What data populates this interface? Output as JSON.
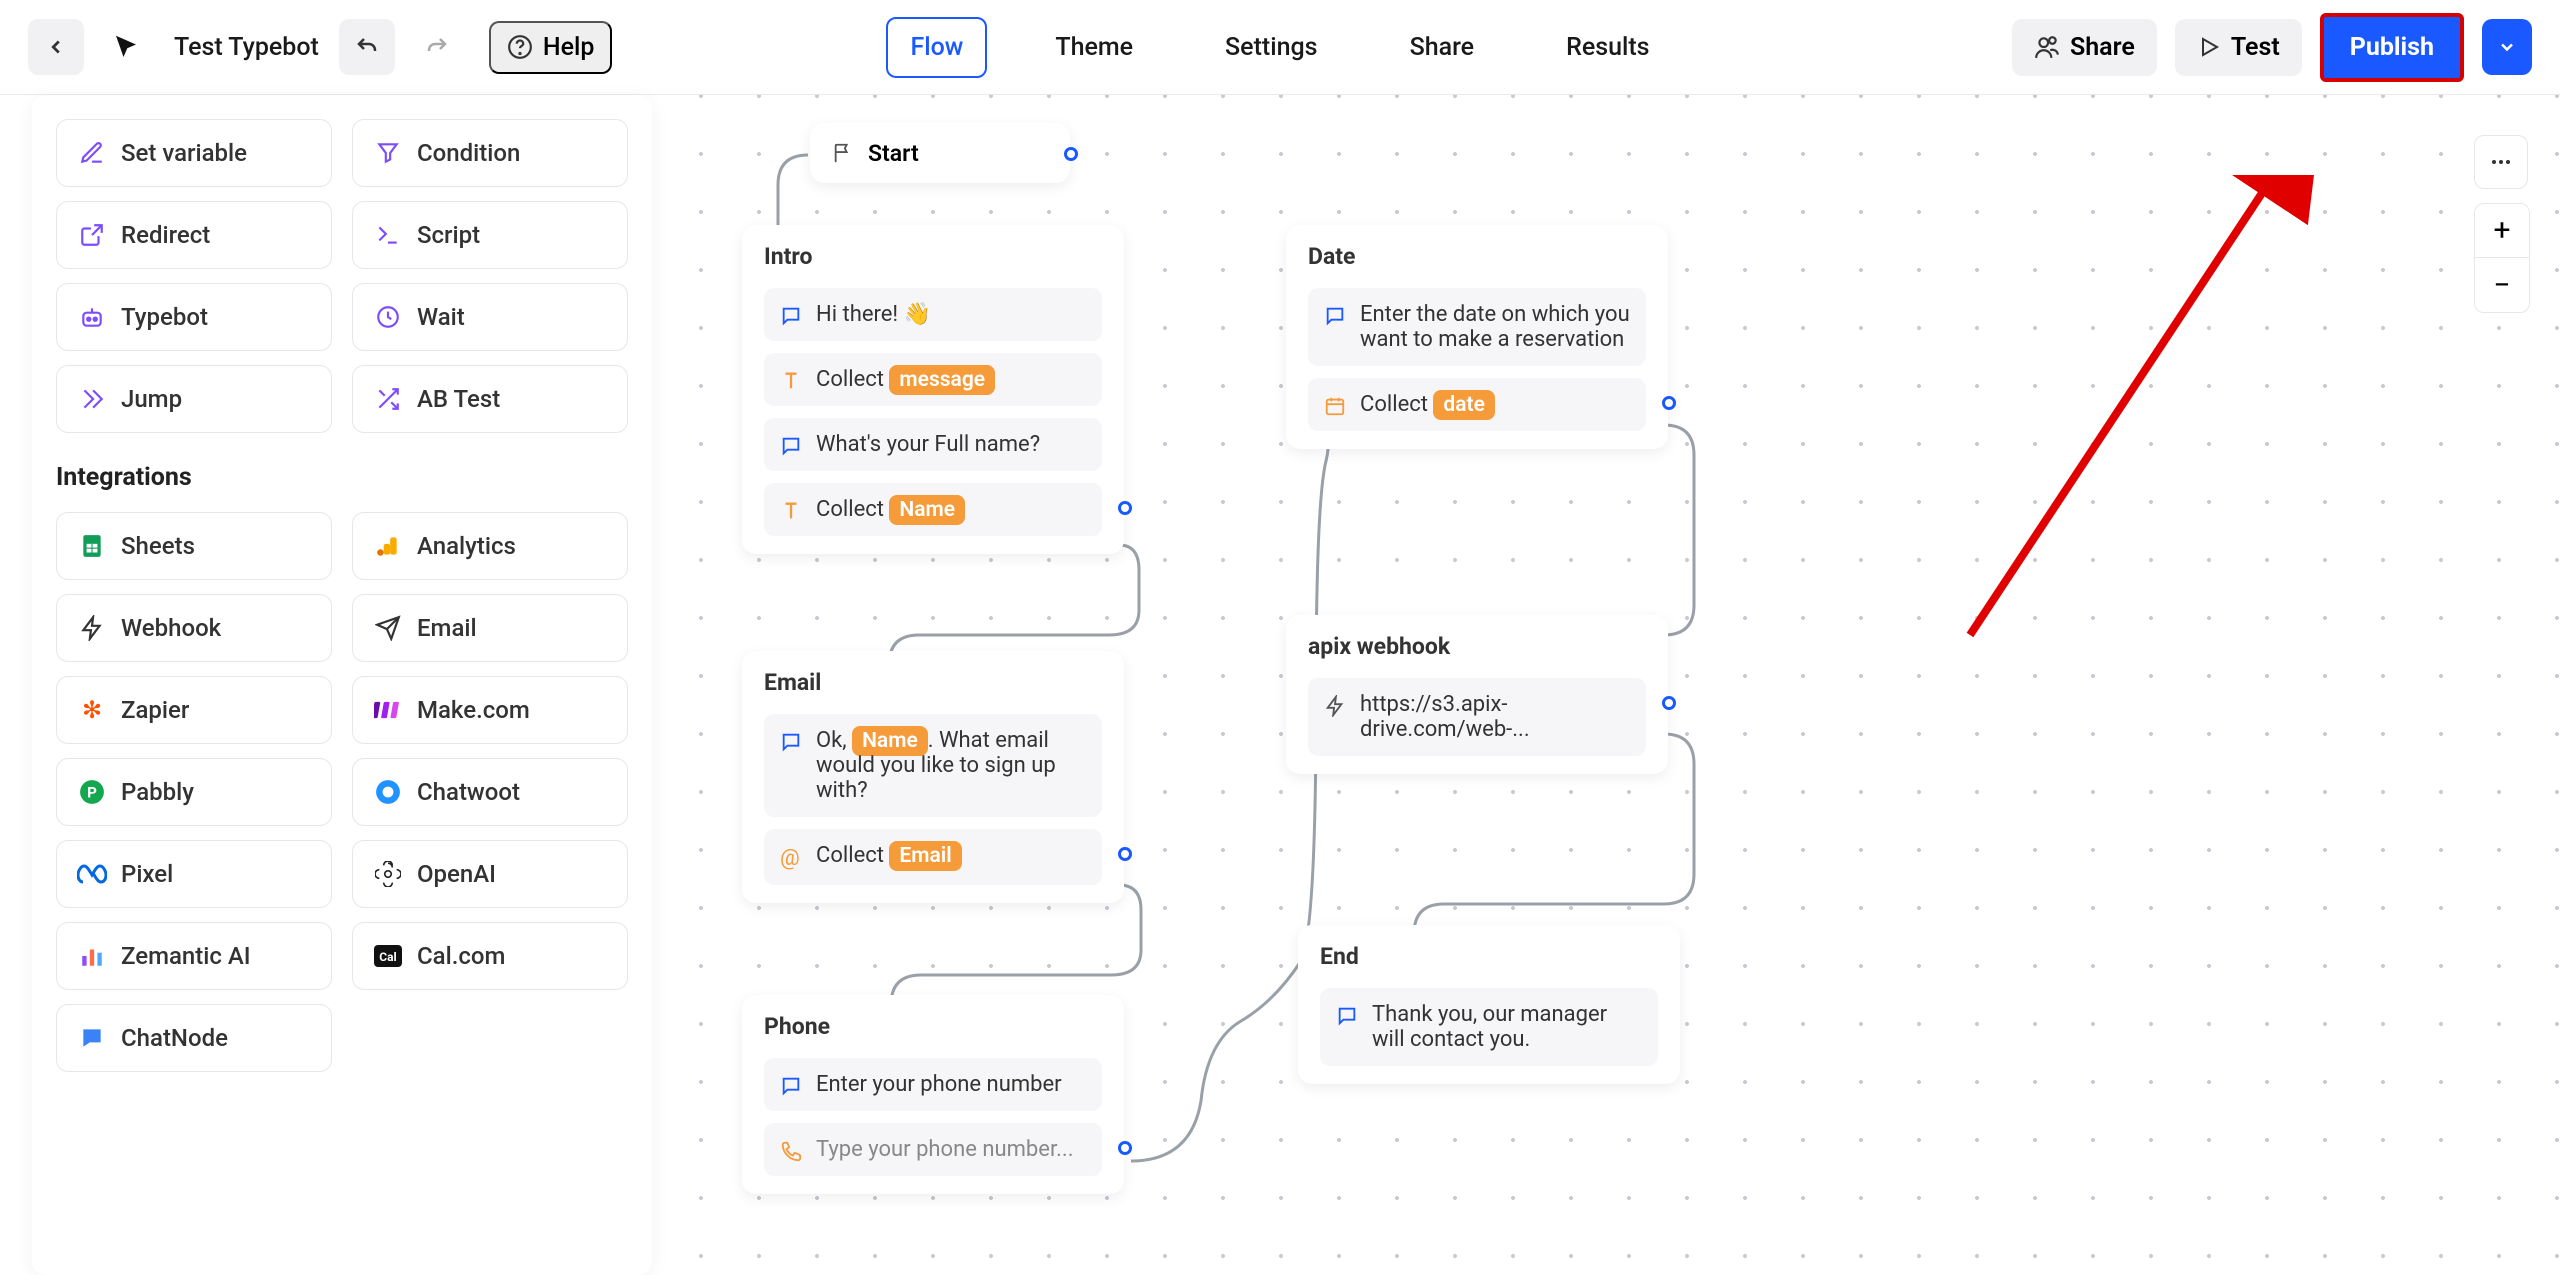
{
  "header": {
    "title": "Test Typebot",
    "help": "Help",
    "tabs": {
      "flow": "Flow",
      "theme": "Theme",
      "settings": "Settings",
      "share": "Share",
      "results": "Results"
    },
    "share_btn": "Share",
    "test_btn": "Test",
    "publish_btn": "Publish"
  },
  "palette": {
    "blocks": [
      {
        "icon": "pencil",
        "label": "Set variable"
      },
      {
        "icon": "filter",
        "label": "Condition"
      },
      {
        "icon": "redirect",
        "label": "Redirect"
      },
      {
        "icon": "script",
        "label": "Script"
      },
      {
        "icon": "bot",
        "label": "Typebot"
      },
      {
        "icon": "clock",
        "label": "Wait"
      },
      {
        "icon": "jump",
        "label": "Jump"
      },
      {
        "icon": "abtest",
        "label": "AB Test"
      }
    ],
    "integrations_h": "Integrations",
    "integrations": [
      {
        "icon": "sheets",
        "label": "Sheets"
      },
      {
        "icon": "analytics",
        "label": "Analytics"
      },
      {
        "icon": "webhook",
        "label": "Webhook"
      },
      {
        "icon": "email",
        "label": "Email"
      },
      {
        "icon": "zapier",
        "label": "Zapier"
      },
      {
        "icon": "make",
        "label": "Make.com"
      },
      {
        "icon": "pabbly",
        "label": "Pabbly"
      },
      {
        "icon": "chatwoot",
        "label": "Chatwoot"
      },
      {
        "icon": "pixel",
        "label": "Pixel"
      },
      {
        "icon": "openai",
        "label": "OpenAI"
      },
      {
        "icon": "zemantic",
        "label": "Zemantic AI"
      },
      {
        "icon": "calcom",
        "label": "Cal.com"
      },
      {
        "icon": "chatnode",
        "label": "ChatNode"
      }
    ]
  },
  "flow": {
    "start": "Start",
    "intro": {
      "title": "Intro",
      "b1": "Hi there!  👋",
      "b2_pre": "Collect ",
      "b2_tag": "message",
      "b3": "What's your Full name?",
      "b4_pre": "Collect ",
      "b4_tag": "Name"
    },
    "email": {
      "title": "Email",
      "b1_pre": "Ok, ",
      "b1_tag": "Name",
      "b1_post": ". What email would you like to sign up with?",
      "b2_pre": "Collect ",
      "b2_tag": "Email"
    },
    "phone": {
      "title": "Phone",
      "b1": "Enter your phone number",
      "b2": "Type your phone number..."
    },
    "date": {
      "title": "Date",
      "b1": "Enter the date on which you want to make a reservation",
      "b2_pre": "Collect ",
      "b2_tag": "date"
    },
    "webhook": {
      "title": "apix webhook",
      "b1": "https://s3.apix-drive.com/web-..."
    },
    "end": {
      "title": "End",
      "b1": "Thank you, our manager will contact you."
    }
  }
}
